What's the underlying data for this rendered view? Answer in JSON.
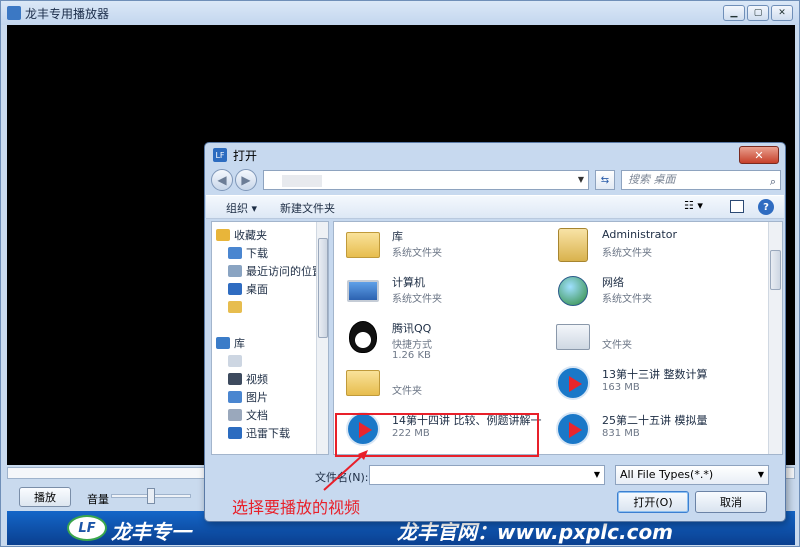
{
  "player": {
    "title": "龙丰专用播放器",
    "play_label": "播放",
    "volume_label": "音量",
    "volume_level": 0.45,
    "banner_text_left": "龙丰专一",
    "banner_text_right": "龙丰官网：www.pxplc.com"
  },
  "dialog": {
    "title": "打开",
    "close_glyph": "✕",
    "search_placeholder": "搜索 桌面",
    "toolbar": {
      "organize": "组织 ▾",
      "new_folder": "新建文件夹"
    },
    "nav_items": [
      {
        "label": "收藏夹",
        "icon": "star-icon",
        "color": "#e8b53a"
      },
      {
        "label": "下载",
        "icon": "download-folder-icon",
        "color": "#4a86d0"
      },
      {
        "label": "最近访问的位置",
        "icon": "recent-icon",
        "color": "#8aa4c2"
      },
      {
        "label": "桌面",
        "icon": "desktop-icon",
        "color": "#2f6cc1"
      },
      {
        "label": "",
        "icon": "folder-icon",
        "color": "#e7bd4e"
      },
      {
        "label": "库",
        "icon": "library-icon",
        "color": "#3b7cc8"
      },
      {
        "label": "",
        "icon": "folder-icon",
        "color": "#cdd6e2"
      },
      {
        "label": "视频",
        "icon": "video-icon",
        "color": "#3d4a5e"
      },
      {
        "label": "图片",
        "icon": "pictures-icon",
        "color": "#4a86d0"
      },
      {
        "label": "文档",
        "icon": "documents-icon",
        "color": "#9aa8bc"
      },
      {
        "label": "迅雷下载",
        "icon": "thunder-icon",
        "color": "#2c6cc0"
      }
    ],
    "files": [
      {
        "name": "库",
        "sub": "系统文件夹",
        "icon": "library-icon",
        "kind": "folder"
      },
      {
        "name": "Administrator",
        "sub": "系统文件夹",
        "icon": "user-folder-icon",
        "kind": "user-ico"
      },
      {
        "name": "计算机",
        "sub": "系统文件夹",
        "icon": "computer-icon",
        "kind": "pc"
      },
      {
        "name": "网络",
        "sub": "系统文件夹",
        "icon": "network-icon",
        "kind": "globe"
      },
      {
        "name": "腾讯QQ",
        "sub": "快捷方式",
        "sub2": "1.26 KB",
        "icon": "qq-icon",
        "kind": "qq"
      },
      {
        "name": "",
        "sub": "文件夹",
        "icon": "folder-icon",
        "kind": "lib"
      },
      {
        "name": "",
        "sub": "文件夹",
        "icon": "folder-icon",
        "kind": "folder"
      },
      {
        "name": "13第十三讲 整数计算",
        "sub": "163 MB",
        "icon": "video-file-icon",
        "kind": "player-ico"
      },
      {
        "name": "14第十四讲 比较、例题讲解一",
        "sub": "222 MB",
        "icon": "video-file-icon",
        "kind": "player-ico"
      },
      {
        "name": "25第二十五讲 模拟量",
        "sub": "831 MB",
        "icon": "video-file-icon",
        "kind": "player-ico"
      }
    ],
    "filename_label": "文件名(N):",
    "filename_value": "",
    "filetype_value": "All File Types(*.*)",
    "open_label": "打开(O)",
    "cancel_label": "取消"
  },
  "annotation": "选择要播放的视频"
}
